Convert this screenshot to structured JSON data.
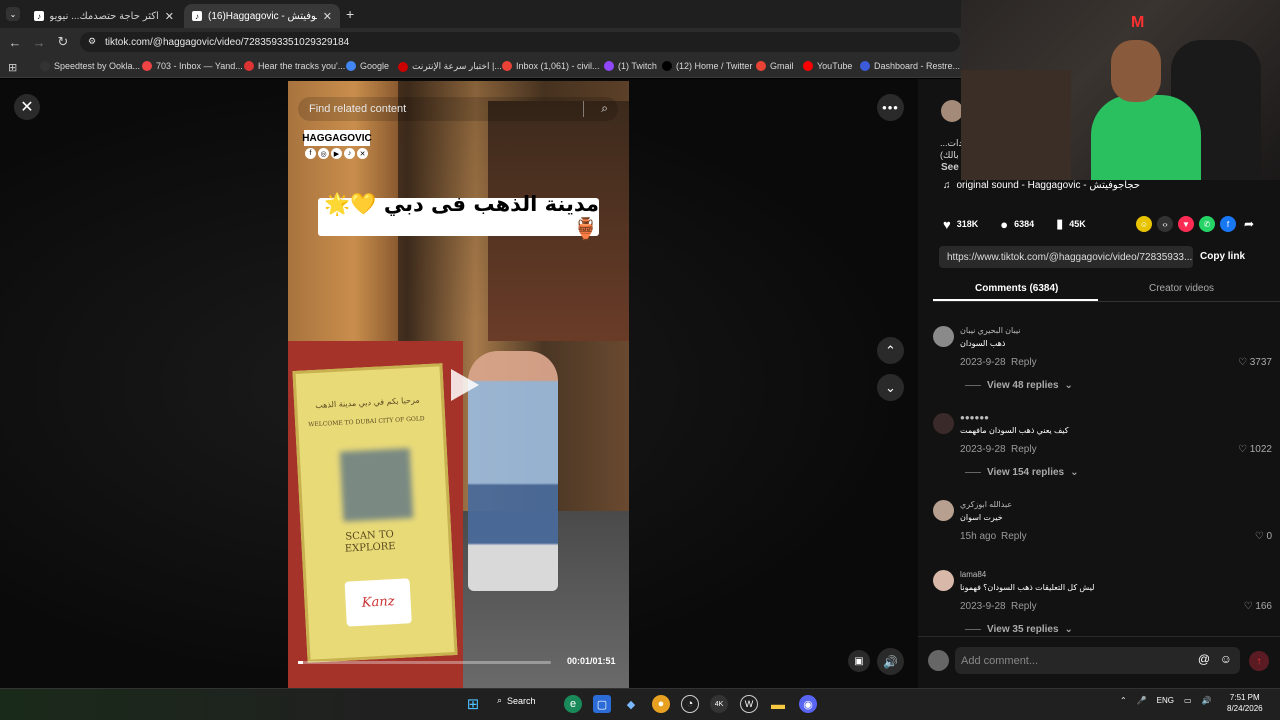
{
  "browser": {
    "tabs": [
      {
        "title": "أكثر حاجة حتصدمك... نيويورك",
        "active": false
      },
      {
        "title": "(16)Haggagovic - حجاجوفيتش (@",
        "active": true
      }
    ],
    "new_tab": "+",
    "url": "tiktok.com/@haggagovic/video/7283593351029329184",
    "bookmarks": [
      {
        "label": "Speedtest by Ookla...",
        "color": "#333333"
      },
      {
        "label": "703 - Inbox — Yand...",
        "color": "#e44"
      },
      {
        "label": "Hear the tracks you'...",
        "color": "#d33"
      },
      {
        "label": "Google",
        "color": "#4285f4"
      },
      {
        "label": "اختبار سرعة الإنترنت |...",
        "color": "#c00"
      },
      {
        "label": "Inbox (1,061) - civil...",
        "color": "#ea4335"
      },
      {
        "label": "(1) Twitch",
        "color": "#9146ff"
      },
      {
        "label": "(12) Home / Twitter",
        "color": "#000000"
      },
      {
        "label": "Gmail",
        "color": "#ea4335"
      },
      {
        "label": "YouTube",
        "color": "#ff0000"
      },
      {
        "label": "Dashboard - Restre...",
        "color": "#3b5bdb"
      }
    ]
  },
  "video": {
    "search_placeholder": "Find related content",
    "brand": "HAGGAGOVIC",
    "caption": "مدينة الذهب فى دبي 💛🌟🏺",
    "time": "00:01/01:51",
    "progress": 0.02
  },
  "panel": {
    "description_lines": [
      "...ردات،",
      "(بالك",
      "...بينت"
    ],
    "see_more": "See",
    "music": "original sound - Haggagovic - حجاجوفيتش",
    "likes": "318K",
    "comments_count": "6384",
    "saves": "45K",
    "link": "https://www.tiktok.com/@haggagovic/video/72835933...",
    "copy_link": "Copy link",
    "tab_comments": "Comments (6384)",
    "tab_creator": "Creator videos",
    "comments": [
      {
        "user": "نيبان البحيري نيبان",
        "text": "ذهب السودان",
        "date": "2023-9-28",
        "reply": "Reply",
        "likes": "3737",
        "view": "View 48 replies"
      },
      {
        "user": "●●●●●●",
        "text": "كيف يعني ذهب السودان مافهمت",
        "date": "2023-9-28",
        "reply": "Reply",
        "likes": "1022",
        "view": "View 154 replies"
      },
      {
        "user": "عبدالله ابوزكري",
        "text": "خيرت اسوان",
        "date": "15h ago",
        "reply": "Reply",
        "likes": "0",
        "view": ""
      },
      {
        "user": "lama84",
        "text": "ليش كل التعليقات ذهب السودان؟ فهمونا",
        "date": "2023-9-28",
        "reply": "Reply",
        "likes": "166",
        "view": "View 35 replies"
      }
    ],
    "add_comment": "Add comment..."
  },
  "taskbar": {
    "search": "Search",
    "lang": "ENG",
    "time": "7:51 PM",
    "date": "8/24/2026"
  }
}
